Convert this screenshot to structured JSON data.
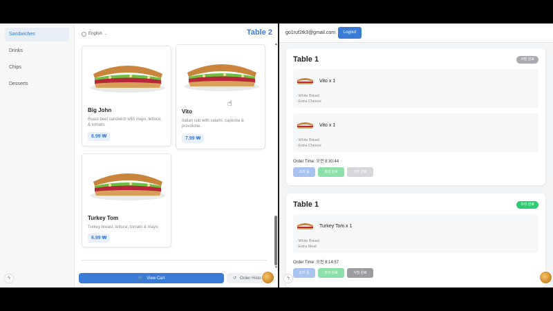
{
  "left": {
    "categories": [
      "Sandwiches",
      "Drinks",
      "Chips",
      "Desserts"
    ],
    "language": "English",
    "table_title": "Table 2",
    "menu": [
      {
        "name": "Big John",
        "desc": "Roast beef sandwich with mayo, lettuce, & tomato.",
        "price": "6.99 ₩"
      },
      {
        "name": "Vito",
        "desc": "Italian sub with salami, capicola & provolone.",
        "price": "7.99 ₩"
      },
      {
        "name": "Turkey Tom",
        "desc": "Turkey breast, lettuce, tomato & mayo.",
        "price": "6.99 ₩"
      }
    ],
    "view_cart": "View Cart",
    "order_history": "Order History"
  },
  "right": {
    "email": "go1ruf2tk3@gmail.com",
    "logout": "Logout",
    "orders": [
      {
        "table": "Table 1",
        "badge": "서빙 완료",
        "badge_color": "#a9abb0",
        "items": [
          {
            "name": "Vito x 1",
            "opts": [
              "- White Bread",
              "- Extra Cheese"
            ]
          },
          {
            "name": "Vito x 1",
            "opts": [
              "- White Bread",
              "- Extra Cheese"
            ]
          }
        ],
        "time": "Order Time: 오전 8:30:44",
        "buttons": [
          "조리 중",
          "조리 완료",
          "서빙 완료"
        ]
      },
      {
        "table": "Table 1",
        "badge": "조리 완료",
        "badge_color": "#2ecc71",
        "items": [
          {
            "name": "Turkey Tom x 1",
            "opts": [
              "- White Bread",
              "- Extra Meat"
            ]
          }
        ],
        "time": "Order Time: 오전 8:14:57",
        "buttons": [
          "조리 중",
          "조리 완료",
          "서빙 완료"
        ]
      }
    ]
  },
  "colors": {
    "accent": "#3a7bd5",
    "served": "#a9abb0",
    "cooked": "#2ecc71"
  }
}
